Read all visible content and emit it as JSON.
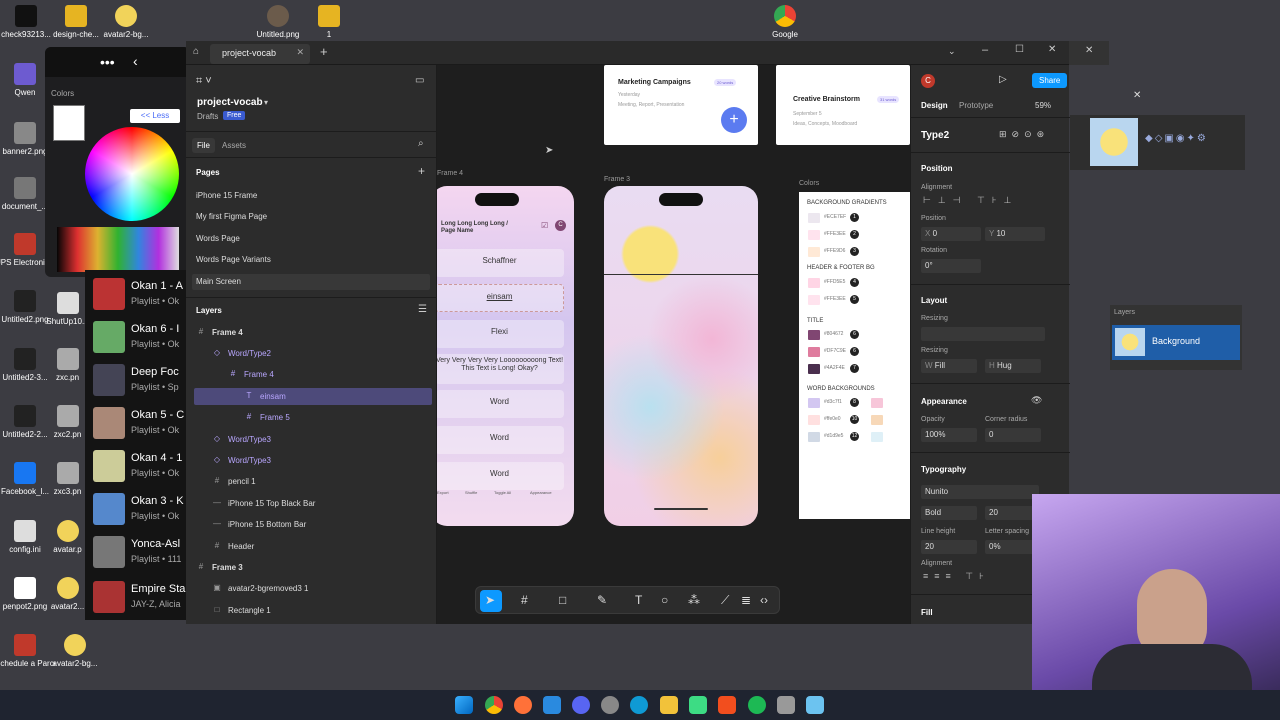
{
  "desktop_icons": [
    {
      "label": "check93213...",
      "color": "#111111"
    },
    {
      "label": "design-che...",
      "color": "#e6b422"
    },
    {
      "label": "avatar2-bg...",
      "color": "#f1d35a"
    },
    {
      "label": "Untitled.png",
      "color": "#6b5b4b"
    },
    {
      "label": "1",
      "color": "#e6b422"
    },
    {
      "label": "Google",
      "color": "#4285f4"
    }
  ],
  "left_icons": [
    {
      "label": "Qwen",
      "color": "#6d5bd0"
    },
    {
      "label": "banner2.png",
      "color": "#888888"
    },
    {
      "label": "document_...",
      "color": "#777777"
    },
    {
      "label": "UPS Electronic R...",
      "color": "#c0392b"
    },
    {
      "label": "Untitled2.png",
      "color": "#222222"
    },
    {
      "label": "Untitled2-3...",
      "color": "#222222"
    },
    {
      "label": "Untitled2-2...",
      "color": "#222222"
    },
    {
      "label": "Facebook_l...",
      "color": "#1877f2"
    },
    {
      "label": "config.ini",
      "color": "#dddddd"
    },
    {
      "label": "penpot2.png",
      "color": "#ffffff"
    },
    {
      "label": "Schedule a Parcel Coll...",
      "color": "#c0392b"
    }
  ],
  "second_col_icons": [
    {
      "label": "ShutUp10...",
      "color": "#dddddd"
    },
    {
      "label": "zxc.pn",
      "color": "#aaaaaa"
    },
    {
      "label": "zxc2.pn",
      "color": "#aaaaaa"
    },
    {
      "label": "zxc3.pn",
      "color": "#aaaaaa"
    },
    {
      "label": "avatar.p",
      "color": "#f1d35a"
    },
    {
      "label": "avatar2...",
      "color": "#f1d35a"
    },
    {
      "label": "avatar2-bg...",
      "color": "#f1d35a"
    }
  ],
  "color_picker": {
    "title": "Colors",
    "less_label": "<< Less"
  },
  "spotify": {
    "rows": [
      {
        "title": "Okan 1 - A",
        "sub": "Playlist • Ok",
        "color": "#b33"
      },
      {
        "title": "Okan 6 - I",
        "sub": "Playlist • Ok",
        "color": "#6a6"
      },
      {
        "title": "Deep Foc",
        "sub": "Playlist • Sp",
        "color": "#445"
      },
      {
        "title": "Okan 5 - C",
        "sub": "Playlist • Ok",
        "color": "#a87"
      },
      {
        "title": "Okan 4 - 1",
        "sub": "Playlist • Ok",
        "color": "#cc9"
      },
      {
        "title": "Okan 3 - K",
        "sub": "Playlist • Ok",
        "color": "#58c"
      },
      {
        "title": "Yonca-Asl",
        "sub": "Playlist • 111",
        "color": "#777"
      },
      {
        "title": "Empire Sta",
        "sub": "JAY-Z, Alicia",
        "color": "#a33"
      }
    ]
  },
  "figma": {
    "tab_title": "project-vocab",
    "project_name": "project-vocab",
    "drafts": "Drafts",
    "plan": "Free",
    "file_tab": "File",
    "assets_tab": "Assets",
    "pages_label": "Pages",
    "pages": [
      "iPhone 15 Frame",
      "My first Figma Page",
      "Words Page",
      "Words Page Variants",
      "Main Screen"
    ],
    "layers_label": "Layers",
    "layers": [
      {
        "name": "Frame 4",
        "glyph": "#",
        "indent": 0,
        "purple": false,
        "bold": true
      },
      {
        "name": "Word/Type2",
        "glyph": "◇",
        "indent": 1,
        "purple": true,
        "bold": false
      },
      {
        "name": "Frame 4",
        "glyph": "#",
        "indent": 2,
        "purple": true,
        "bold": false
      },
      {
        "name": "einsam",
        "glyph": "T",
        "indent": 3,
        "purple": true,
        "bold": false,
        "selected": true
      },
      {
        "name": "Frame 5",
        "glyph": "#",
        "indent": 3,
        "purple": true,
        "bold": false
      },
      {
        "name": "Word/Type3",
        "glyph": "◇",
        "indent": 1,
        "purple": true,
        "bold": false
      },
      {
        "name": "Word/Type3",
        "glyph": "◇",
        "indent": 1,
        "purple": true,
        "bold": false
      },
      {
        "name": "pencil 1",
        "glyph": "#",
        "indent": 1,
        "purple": false,
        "bold": false
      },
      {
        "name": "iPhone 15 Top Black Bar",
        "glyph": "—",
        "indent": 1,
        "purple": false,
        "bold": false
      },
      {
        "name": "iPhone 15 Bottom Bar",
        "glyph": "—",
        "indent": 1,
        "purple": false,
        "bold": false
      },
      {
        "name": "Header",
        "glyph": "#",
        "indent": 1,
        "purple": false,
        "bold": false
      },
      {
        "name": "Frame 3",
        "glyph": "#",
        "indent": 0,
        "purple": false,
        "bold": true
      },
      {
        "name": "avatar2-bgremoved3 1",
        "glyph": "▣",
        "indent": 1,
        "purple": false,
        "bold": false
      },
      {
        "name": "Rectangle 1",
        "glyph": "□",
        "indent": 1,
        "purple": false,
        "bold": false
      }
    ],
    "canvas": {
      "frame4_label": "Frame 4",
      "frame3_label": "Frame 3",
      "colors_label": "Colors",
      "header_title": "Long Long Long Long / Page Name",
      "words": [
        "Schaffner",
        "einsam",
        "Flexi",
        "Very Very Very Very Looooooooong Text! This Text is Long! Okay?",
        "Word",
        "Word",
        "Word"
      ],
      "bottom_nav": [
        "Export",
        "Shuffle",
        "Toggle All",
        "Appearance"
      ],
      "card1_title": "Marketing Campaigns",
      "card1_badge": "20 words",
      "card1_date": "Yesterday",
      "card1_tags": "Meeting, Report, Presentation",
      "card2_title": "Creative Brainstorm",
      "card2_badge": "31 words",
      "card2_date": "September 5",
      "card2_tags": "Ideas, Concepts, Moodboard",
      "palette": {
        "sections": [
          {
            "title": "BACKGROUND GRADIENTS",
            "items": [
              {
                "hex": "#ECE7EF",
                "n": "1",
                "color": "#ece7ef"
              },
              {
                "hex": "#FFE3EE",
                "n": "2",
                "color": "#ffe3ee"
              },
              {
                "hex": "#FFE9D6",
                "n": "3",
                "color": "#ffe9d6"
              }
            ]
          },
          {
            "title": "HEADER & FOOTER BG",
            "items": [
              {
                "hex": "#FFD5E5",
                "n": "4",
                "color": "#ffd5e5"
              },
              {
                "hex": "#FFE3EE",
                "n": "5",
                "color": "#ffe3ee"
              }
            ]
          },
          {
            "title": "TITLE",
            "items": [
              {
                "hex": "#804672",
                "n": "6",
                "color": "#804672"
              },
              {
                "hex": "#DF7C9E",
                "n": "6",
                "color": "#df7c9e"
              },
              {
                "hex": "#4A2F4E",
                "n": "7",
                "color": "#4a2f4e"
              }
            ]
          },
          {
            "title": "WORD BACKGROUNDS",
            "items": [
              {
                "hex": "#d3c7f1",
                "n": "8",
                "color": "#d3c7f1"
              },
              {
                "hex": "#ffe0e0",
                "n": "10",
                "color": "#ffe0e0"
              },
              {
                "hex": "#d1d9e5",
                "n": "12",
                "color": "#d1d9e5"
              }
            ]
          }
        ]
      }
    },
    "right_panel": {
      "avatar_letter": "C",
      "share_label": "Share",
      "design_tab": "Design",
      "prototype_tab": "Prototype",
      "zoom": "59%",
      "selected_name": "Type2",
      "position_label": "Position",
      "alignment_label": "Alignment",
      "position_sub": "Position",
      "x_label": "X",
      "x_value": "0",
      "y_label": "Y",
      "y_value": "10",
      "rotation_label": "Rotation",
      "rotation_value": "0°",
      "layout_label": "Layout",
      "resizing_label": "Resizing",
      "resizing_sub": "Resizing",
      "w_label": "W",
      "w_value": "Fill",
      "h_label": "H",
      "h_value": "Hug",
      "appearance_label": "Appearance",
      "opacity_label": "Opacity",
      "opacity_value": "100%",
      "radius_label": "Corner radius",
      "radius_value": "0",
      "typography_label": "Typography",
      "font": "Nunito",
      "weight": "Bold",
      "size": "20",
      "lh_label": "Line height",
      "lh_value": "20",
      "ls_label": "Letter spacing",
      "ls_value": "0%",
      "align_label": "Alignment",
      "fill_label": "Fill"
    },
    "toolbar_icons": [
      "move-tool",
      "frame-tool",
      "shape-tool",
      "pen-tool",
      "text-tool",
      "comment-tool",
      "actions-tool",
      "dev-mode"
    ]
  },
  "layers_window": {
    "title": "Layers",
    "item": "Background"
  },
  "taskbar_icons": [
    "windows",
    "chrome",
    "firefox",
    "vscode",
    "discord",
    "settings",
    "explorer",
    "edge",
    "android-studio",
    "figma",
    "spotify",
    "app",
    "app2"
  ]
}
